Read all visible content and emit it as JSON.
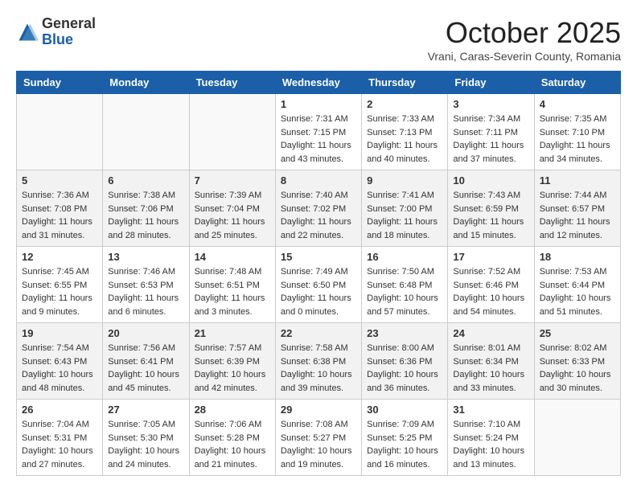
{
  "header": {
    "logo_general": "General",
    "logo_blue": "Blue",
    "month_title": "October 2025",
    "subtitle": "Vrani, Caras-Severin County, Romania"
  },
  "days_of_week": [
    "Sunday",
    "Monday",
    "Tuesday",
    "Wednesday",
    "Thursday",
    "Friday",
    "Saturday"
  ],
  "weeks": [
    [
      {
        "day": "",
        "info": ""
      },
      {
        "day": "",
        "info": ""
      },
      {
        "day": "",
        "info": ""
      },
      {
        "day": "1",
        "info": "Sunrise: 7:31 AM\nSunset: 7:15 PM\nDaylight: 11 hours\nand 43 minutes."
      },
      {
        "day": "2",
        "info": "Sunrise: 7:33 AM\nSunset: 7:13 PM\nDaylight: 11 hours\nand 40 minutes."
      },
      {
        "day": "3",
        "info": "Sunrise: 7:34 AM\nSunset: 7:11 PM\nDaylight: 11 hours\nand 37 minutes."
      },
      {
        "day": "4",
        "info": "Sunrise: 7:35 AM\nSunset: 7:10 PM\nDaylight: 11 hours\nand 34 minutes."
      }
    ],
    [
      {
        "day": "5",
        "info": "Sunrise: 7:36 AM\nSunset: 7:08 PM\nDaylight: 11 hours\nand 31 minutes."
      },
      {
        "day": "6",
        "info": "Sunrise: 7:38 AM\nSunset: 7:06 PM\nDaylight: 11 hours\nand 28 minutes."
      },
      {
        "day": "7",
        "info": "Sunrise: 7:39 AM\nSunset: 7:04 PM\nDaylight: 11 hours\nand 25 minutes."
      },
      {
        "day": "8",
        "info": "Sunrise: 7:40 AM\nSunset: 7:02 PM\nDaylight: 11 hours\nand 22 minutes."
      },
      {
        "day": "9",
        "info": "Sunrise: 7:41 AM\nSunset: 7:00 PM\nDaylight: 11 hours\nand 18 minutes."
      },
      {
        "day": "10",
        "info": "Sunrise: 7:43 AM\nSunset: 6:59 PM\nDaylight: 11 hours\nand 15 minutes."
      },
      {
        "day": "11",
        "info": "Sunrise: 7:44 AM\nSunset: 6:57 PM\nDaylight: 11 hours\nand 12 minutes."
      }
    ],
    [
      {
        "day": "12",
        "info": "Sunrise: 7:45 AM\nSunset: 6:55 PM\nDaylight: 11 hours\nand 9 minutes."
      },
      {
        "day": "13",
        "info": "Sunrise: 7:46 AM\nSunset: 6:53 PM\nDaylight: 11 hours\nand 6 minutes."
      },
      {
        "day": "14",
        "info": "Sunrise: 7:48 AM\nSunset: 6:51 PM\nDaylight: 11 hours\nand 3 minutes."
      },
      {
        "day": "15",
        "info": "Sunrise: 7:49 AM\nSunset: 6:50 PM\nDaylight: 11 hours\nand 0 minutes."
      },
      {
        "day": "16",
        "info": "Sunrise: 7:50 AM\nSunset: 6:48 PM\nDaylight: 10 hours\nand 57 minutes."
      },
      {
        "day": "17",
        "info": "Sunrise: 7:52 AM\nSunset: 6:46 PM\nDaylight: 10 hours\nand 54 minutes."
      },
      {
        "day": "18",
        "info": "Sunrise: 7:53 AM\nSunset: 6:44 PM\nDaylight: 10 hours\nand 51 minutes."
      }
    ],
    [
      {
        "day": "19",
        "info": "Sunrise: 7:54 AM\nSunset: 6:43 PM\nDaylight: 10 hours\nand 48 minutes."
      },
      {
        "day": "20",
        "info": "Sunrise: 7:56 AM\nSunset: 6:41 PM\nDaylight: 10 hours\nand 45 minutes."
      },
      {
        "day": "21",
        "info": "Sunrise: 7:57 AM\nSunset: 6:39 PM\nDaylight: 10 hours\nand 42 minutes."
      },
      {
        "day": "22",
        "info": "Sunrise: 7:58 AM\nSunset: 6:38 PM\nDaylight: 10 hours\nand 39 minutes."
      },
      {
        "day": "23",
        "info": "Sunrise: 8:00 AM\nSunset: 6:36 PM\nDaylight: 10 hours\nand 36 minutes."
      },
      {
        "day": "24",
        "info": "Sunrise: 8:01 AM\nSunset: 6:34 PM\nDaylight: 10 hours\nand 33 minutes."
      },
      {
        "day": "25",
        "info": "Sunrise: 8:02 AM\nSunset: 6:33 PM\nDaylight: 10 hours\nand 30 minutes."
      }
    ],
    [
      {
        "day": "26",
        "info": "Sunrise: 7:04 AM\nSunset: 5:31 PM\nDaylight: 10 hours\nand 27 minutes."
      },
      {
        "day": "27",
        "info": "Sunrise: 7:05 AM\nSunset: 5:30 PM\nDaylight: 10 hours\nand 24 minutes."
      },
      {
        "day": "28",
        "info": "Sunrise: 7:06 AM\nSunset: 5:28 PM\nDaylight: 10 hours\nand 21 minutes."
      },
      {
        "day": "29",
        "info": "Sunrise: 7:08 AM\nSunset: 5:27 PM\nDaylight: 10 hours\nand 19 minutes."
      },
      {
        "day": "30",
        "info": "Sunrise: 7:09 AM\nSunset: 5:25 PM\nDaylight: 10 hours\nand 16 minutes."
      },
      {
        "day": "31",
        "info": "Sunrise: 7:10 AM\nSunset: 5:24 PM\nDaylight: 10 hours\nand 13 minutes."
      },
      {
        "day": "",
        "info": ""
      }
    ]
  ]
}
